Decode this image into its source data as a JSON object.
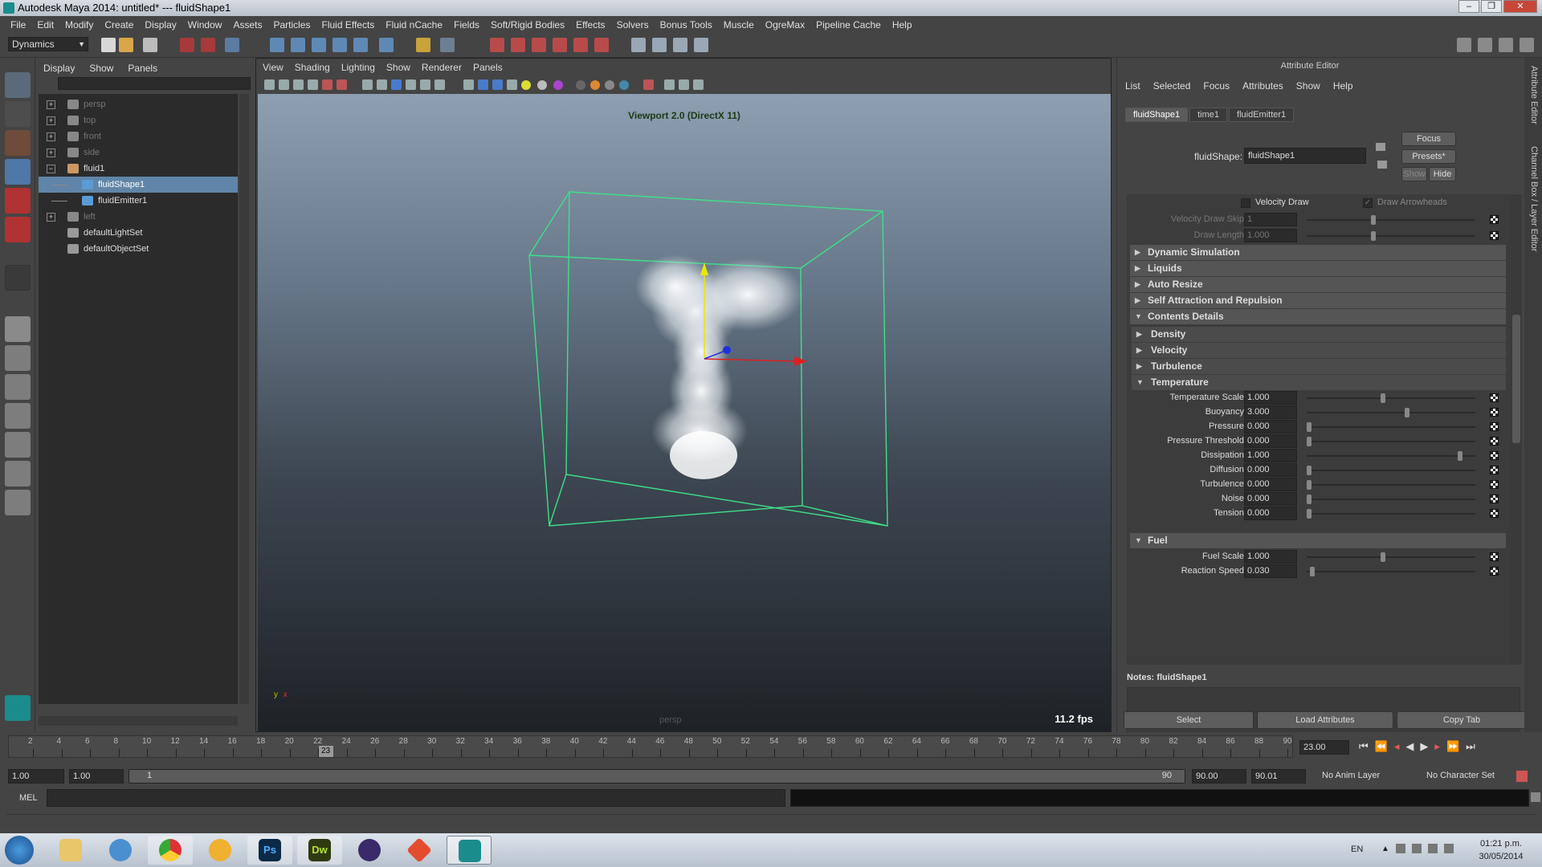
{
  "window": {
    "title": "Autodesk Maya 2014: untitled*   ---   fluidShape1",
    "controls": [
      "–",
      "❐",
      "✕"
    ]
  },
  "menubar": [
    "File",
    "Edit",
    "Modify",
    "Create",
    "Display",
    "Window",
    "Assets",
    "Particles",
    "Fluid Effects",
    "Fluid nCache",
    "Fields",
    "Soft/Rigid Bodies",
    "Effects",
    "Solvers",
    "Bonus Tools",
    "Muscle",
    "OgreMax",
    "Pipeline Cache",
    "Help"
  ],
  "statusline": {
    "mode": "Dynamics"
  },
  "outliner": {
    "menu": [
      "Display",
      "Show",
      "Panels"
    ],
    "items": [
      {
        "label": "persp",
        "dim": true,
        "expander": "+",
        "indent": 0
      },
      {
        "label": "top",
        "dim": true,
        "expander": "+",
        "indent": 0
      },
      {
        "label": "front",
        "dim": true,
        "expander": "+",
        "indent": 0
      },
      {
        "label": "side",
        "dim": true,
        "expander": "+",
        "indent": 0
      },
      {
        "label": "fluid1",
        "dim": false,
        "expander": "−",
        "indent": 0
      },
      {
        "label": "fluidShape1",
        "dim": false,
        "expander": "",
        "indent": 1,
        "selected": true
      },
      {
        "label": "fluidEmitter1",
        "dim": false,
        "expander": "",
        "indent": 1
      },
      {
        "label": "left",
        "dim": true,
        "expander": "+",
        "indent": 0
      },
      {
        "label": "defaultLightSet",
        "dim": false,
        "expander": "",
        "indent": 0
      },
      {
        "label": "defaultObjectSet",
        "dim": false,
        "expander": "",
        "indent": 0
      }
    ]
  },
  "viewport": {
    "menu": [
      "View",
      "Shading",
      "Lighting",
      "Show",
      "Renderer",
      "Panels"
    ],
    "title": "Viewport 2.0 (DirectX 11)",
    "fps": "11.2 fps",
    "camera": "persp",
    "axis_y": "y",
    "axis_x": "x"
  },
  "attribute_editor": {
    "title": "Attribute Editor",
    "menu": [
      "List",
      "Selected",
      "Focus",
      "Attributes",
      "Show",
      "Help"
    ],
    "tabs": [
      "fluidShape1",
      "time1",
      "fluidEmitter1"
    ],
    "focus_label": "Focus",
    "presets_label": "Presets*",
    "show_label": "Show",
    "hide_label": "Hide",
    "node_label": "fluidShape:",
    "node_value": "fluidShape1",
    "velocity_draw": "Velocity Draw",
    "draw_arrowheads": "Draw Arrowheads",
    "velocity_draw_skip_label": "Velocity Draw Skip",
    "velocity_draw_skip": "1",
    "draw_length_label": "Draw Length",
    "draw_length": "1.000",
    "sections": [
      "Dynamic Simulation",
      "Liquids",
      "Auto Resize",
      "Self Attraction and Repulsion",
      "Contents Details"
    ],
    "subsections": [
      "Density",
      "Velocity",
      "Turbulence",
      "Temperature"
    ],
    "temperature": [
      {
        "label": "Temperature Scale",
        "value": "1.000",
        "level": 0.45
      },
      {
        "label": "Buoyancy",
        "value": "3.000",
        "level": 0.6
      },
      {
        "label": "Pressure",
        "value": "0.000",
        "level": 0
      },
      {
        "label": "Pressure Threshold",
        "value": "0.000",
        "level": 0
      },
      {
        "label": "Dissipation",
        "value": "1.000",
        "level": 0.92
      },
      {
        "label": "Diffusion",
        "value": "0.000",
        "level": 0
      },
      {
        "label": "Turbulence",
        "value": "0.000",
        "level": 0
      },
      {
        "label": "Noise",
        "value": "0.000",
        "level": 0
      },
      {
        "label": "Tension",
        "value": "0.000",
        "level": 0
      }
    ],
    "fuel_section": "Fuel",
    "fuel": [
      {
        "label": "Fuel Scale",
        "value": "1.000",
        "level": 0.45
      },
      {
        "label": "Reaction Speed",
        "value": "0.030",
        "level": 0.02
      }
    ],
    "notes_label": "Notes: fluidShape1",
    "buttons": [
      "Select",
      "Load Attributes",
      "Copy Tab"
    ]
  },
  "side_tabs": [
    "Attribute Editor",
    "Channel Box / Layer Editor"
  ],
  "timeline": {
    "ticks": [
      "2",
      "4",
      "6",
      "8",
      "10",
      "12",
      "14",
      "16",
      "18",
      "20",
      "22",
      "24",
      "26",
      "28",
      "30",
      "32",
      "34",
      "36",
      "38",
      "40",
      "42",
      "44",
      "46",
      "48",
      "50",
      "52",
      "54",
      "56",
      "58",
      "60",
      "62",
      "64",
      "66",
      "68",
      "70",
      "72",
      "74",
      "76",
      "78",
      "80",
      "82",
      "84",
      "86",
      "88",
      "90"
    ],
    "current_marker": "23",
    "current_frame": "23.00",
    "current_fraction": 0.25
  },
  "range": {
    "start": "1.00",
    "playback_start": "1.00",
    "slider_start": "1",
    "slider_end": "90",
    "playback_end": "90.00",
    "end": "90.01",
    "anim_layer": "No Anim Layer",
    "character_set": "No Character Set"
  },
  "cmdline": {
    "label": "MEL"
  },
  "taskbar": {
    "lang": "EN",
    "time": "01:21 p.m.",
    "date": "30/05/2014"
  }
}
